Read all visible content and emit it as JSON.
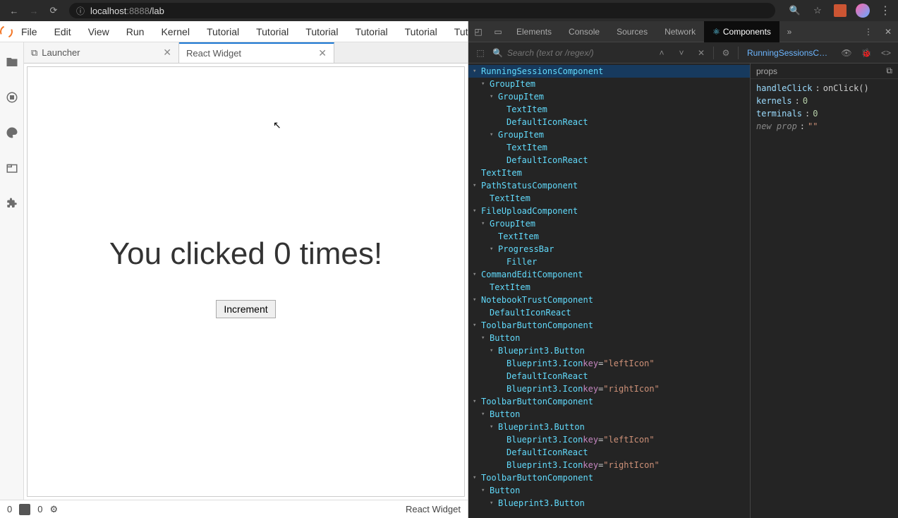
{
  "browser": {
    "url_host": "localhost",
    "url_port": ":8888",
    "url_path": "/lab"
  },
  "jlab": {
    "menus": [
      "File",
      "Edit",
      "View",
      "Run",
      "Kernel",
      "Tutorial",
      "Tutorial",
      "Tutorial",
      "Tutorial",
      "Tutorial",
      "Tutoria"
    ],
    "tabs": [
      {
        "label": "Launcher",
        "active": false
      },
      {
        "label": "React Widget",
        "active": true
      }
    ],
    "widget_heading": "You clicked 0 times!",
    "increment_label": "Increment",
    "status_left_a": "0",
    "status_left_b": "0",
    "status_right": "React Widget"
  },
  "devtools": {
    "tabs": [
      "Elements",
      "Console",
      "Sources",
      "Network",
      "Components"
    ],
    "active_tab": "Components",
    "search_placeholder": "Search (text or /regex/)",
    "selected_label": "RunningSessionsCo…",
    "tree": [
      {
        "d": 0,
        "a": "▾",
        "t": "comp",
        "l": "RunningSessionsComponent",
        "sel": true
      },
      {
        "d": 1,
        "a": "▾",
        "t": "comp",
        "l": "GroupItem"
      },
      {
        "d": 2,
        "a": "▾",
        "t": "comp",
        "l": "GroupItem"
      },
      {
        "d": 3,
        "a": "",
        "t": "comp",
        "l": "TextItem"
      },
      {
        "d": 3,
        "a": "",
        "t": "comp",
        "l": "DefaultIconReact"
      },
      {
        "d": 2,
        "a": "▾",
        "t": "comp",
        "l": "GroupItem"
      },
      {
        "d": 3,
        "a": "",
        "t": "comp",
        "l": "TextItem"
      },
      {
        "d": 3,
        "a": "",
        "t": "comp",
        "l": "DefaultIconReact"
      },
      {
        "d": 0,
        "a": "",
        "t": "comp",
        "l": "TextItem"
      },
      {
        "d": 0,
        "a": "▾",
        "t": "comp",
        "l": "PathStatusComponent"
      },
      {
        "d": 1,
        "a": "",
        "t": "comp",
        "l": "TextItem"
      },
      {
        "d": 0,
        "a": "▾",
        "t": "comp",
        "l": "FileUploadComponent"
      },
      {
        "d": 1,
        "a": "▾",
        "t": "comp",
        "l": "GroupItem"
      },
      {
        "d": 2,
        "a": "",
        "t": "comp",
        "l": "TextItem"
      },
      {
        "d": 2,
        "a": "▾",
        "t": "comp",
        "l": "ProgressBar"
      },
      {
        "d": 3,
        "a": "",
        "t": "comp",
        "l": "Filler"
      },
      {
        "d": 0,
        "a": "▾",
        "t": "comp",
        "l": "CommandEditComponent"
      },
      {
        "d": 1,
        "a": "",
        "t": "comp",
        "l": "TextItem"
      },
      {
        "d": 0,
        "a": "▾",
        "t": "comp",
        "l": "NotebookTrustComponent"
      },
      {
        "d": 1,
        "a": "",
        "t": "comp",
        "l": "DefaultIconReact"
      },
      {
        "d": 0,
        "a": "▾",
        "t": "comp",
        "l": "ToolbarButtonComponent"
      },
      {
        "d": 1,
        "a": "▾",
        "t": "comp",
        "l": "Button"
      },
      {
        "d": 2,
        "a": "▾",
        "t": "comp",
        "l": "Blueprint3.Button"
      },
      {
        "d": 3,
        "a": "",
        "t": "kv",
        "l": "Blueprint3.Icon",
        "k": "key",
        "v": "\"leftIcon\""
      },
      {
        "d": 3,
        "a": "",
        "t": "comp",
        "l": "DefaultIconReact"
      },
      {
        "d": 3,
        "a": "",
        "t": "kv",
        "l": "Blueprint3.Icon",
        "k": "key",
        "v": "\"rightIcon\""
      },
      {
        "d": 0,
        "a": "▾",
        "t": "comp",
        "l": "ToolbarButtonComponent"
      },
      {
        "d": 1,
        "a": "▾",
        "t": "comp",
        "l": "Button"
      },
      {
        "d": 2,
        "a": "▾",
        "t": "comp",
        "l": "Blueprint3.Button"
      },
      {
        "d": 3,
        "a": "",
        "t": "kv",
        "l": "Blueprint3.Icon",
        "k": "key",
        "v": "\"leftIcon\""
      },
      {
        "d": 3,
        "a": "",
        "t": "comp",
        "l": "DefaultIconReact"
      },
      {
        "d": 3,
        "a": "",
        "t": "kv",
        "l": "Blueprint3.Icon",
        "k": "key",
        "v": "\"rightIcon\""
      },
      {
        "d": 0,
        "a": "▾",
        "t": "comp",
        "l": "ToolbarButtonComponent"
      },
      {
        "d": 1,
        "a": "▾",
        "t": "comp",
        "l": "Button"
      },
      {
        "d": 2,
        "a": "▾",
        "t": "comp",
        "l": "Blueprint3.Button"
      }
    ],
    "props_title": "props",
    "props": [
      {
        "key": "handleClick",
        "type": "fn",
        "val": "onClick()"
      },
      {
        "key": "kernels",
        "type": "num",
        "val": "0"
      },
      {
        "key": "terminals",
        "type": "num",
        "val": "0"
      },
      {
        "key": "new prop",
        "type": "new",
        "val": "\"\""
      }
    ]
  }
}
